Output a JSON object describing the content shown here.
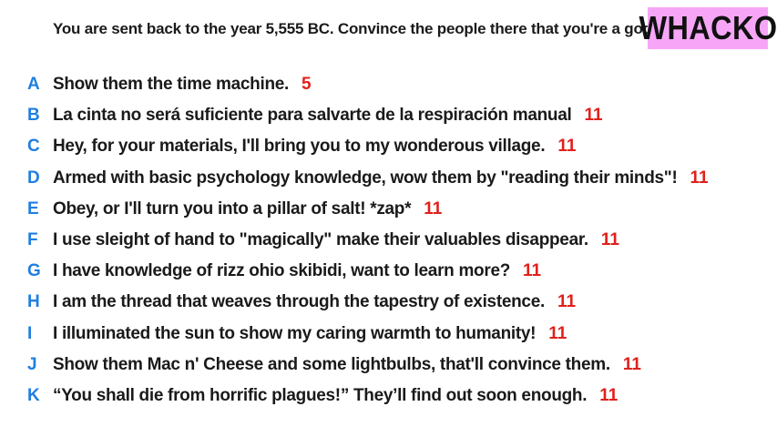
{
  "prompt": "You are sent back to the year 5,555 BC. Convince the people there that you're a god.",
  "badge": "WHACKO",
  "colors": {
    "badge_bg": "#f7a6f7",
    "letter": "#1f7fe0",
    "score": "#e0201b",
    "text": "#1a1a1a"
  },
  "answers": [
    {
      "letter": "A",
      "text": "Show them the time machine.",
      "score": "5"
    },
    {
      "letter": "B",
      "text": "La cinta no será suficiente para salvarte de la respiración manual",
      "score": "11"
    },
    {
      "letter": "C",
      "text": "Hey, for your materials, I'll bring you to my wonderous village.",
      "score": "11"
    },
    {
      "letter": "D",
      "text": "Armed with basic psychology knowledge, wow them by \"reading their minds\"!",
      "score": "11"
    },
    {
      "letter": "E",
      "text": "Obey, or I'll turn you into a pillar of salt! *zap*",
      "score": "11"
    },
    {
      "letter": "F",
      "text": "I use sleight of hand to \"magically\" make their valuables disappear.",
      "score": "11"
    },
    {
      "letter": "G",
      "text": "I have knowledge of rizz ohio skibidi, want to learn more?",
      "score": "11"
    },
    {
      "letter": "H",
      "text": "I am the thread that weaves through the tapestry of existence.",
      "score": "11"
    },
    {
      "letter": "I",
      "text": "I illuminated the sun to show my caring warmth to humanity!",
      "score": "11"
    },
    {
      "letter": "J",
      "text": "Show them Mac n' Cheese and some lightbulbs, that'll convince them.",
      "score": "11"
    },
    {
      "letter": "K",
      "text": "“You shall die from horrific plagues!” They’ll find out soon enough.",
      "score": "11"
    }
  ]
}
